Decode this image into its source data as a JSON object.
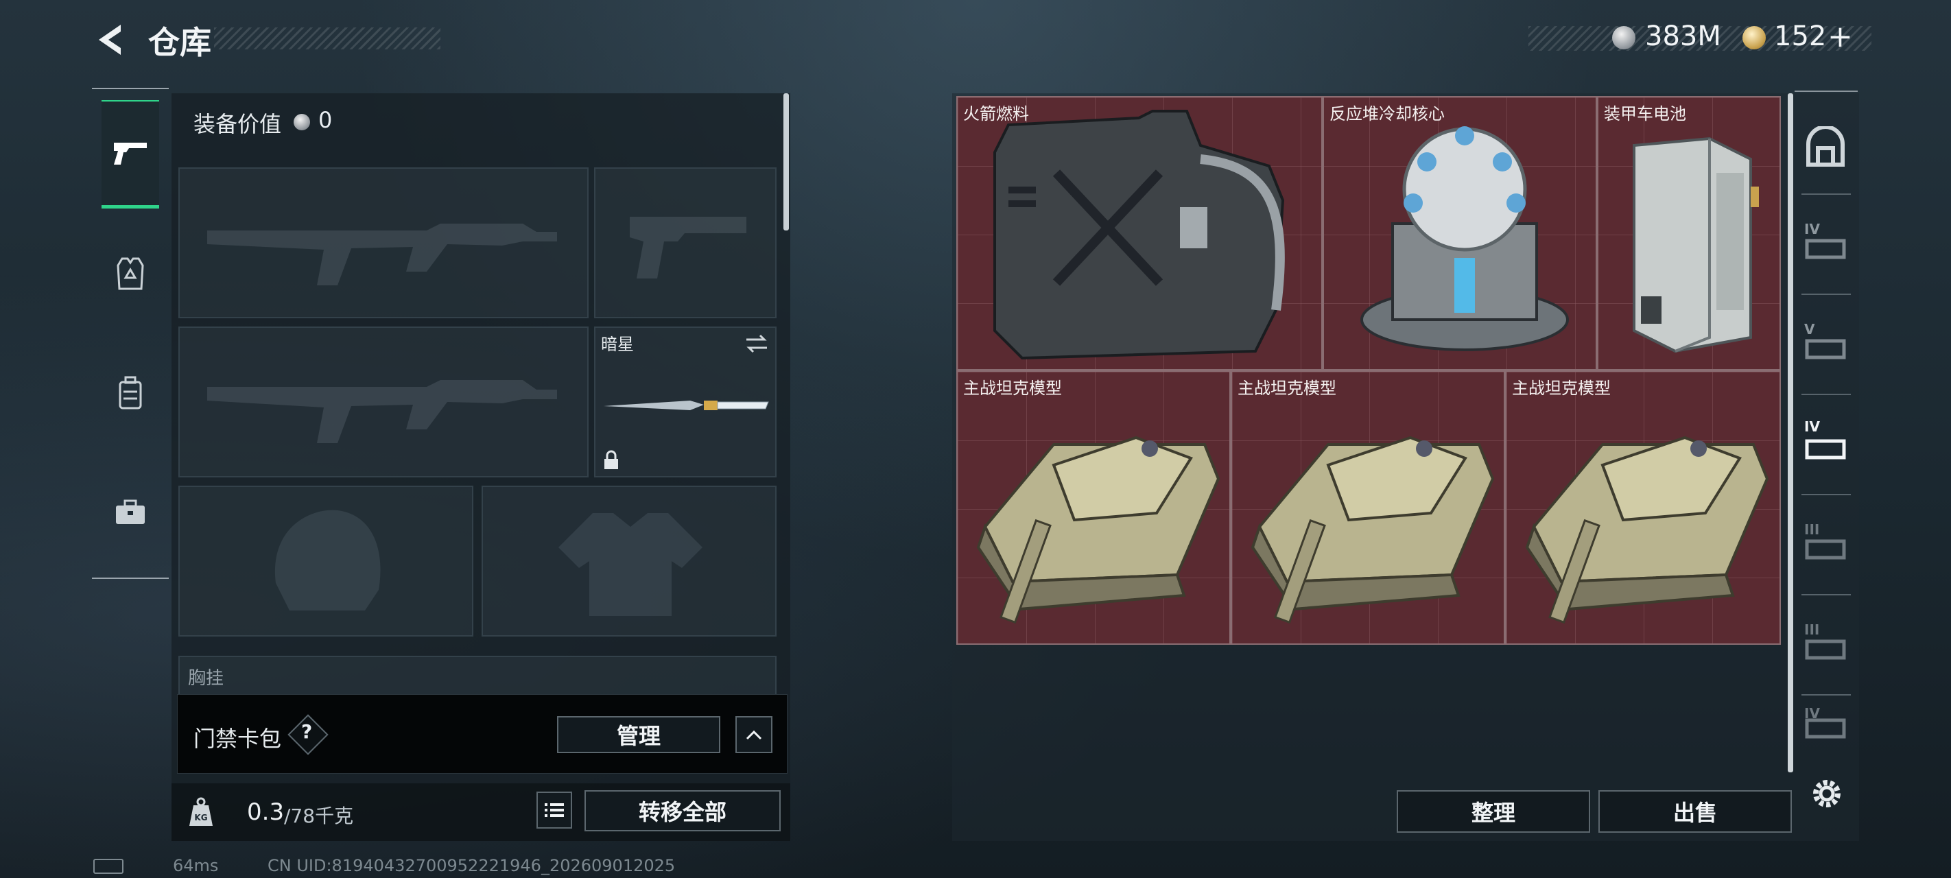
{
  "header": {
    "title": "仓库",
    "currency_silver": "383M",
    "currency_gold": "152",
    "gold_add": "+"
  },
  "left_nav": {
    "items": [
      {
        "name": "weapons",
        "active": true
      },
      {
        "name": "armor",
        "active": false
      },
      {
        "name": "backpack",
        "active": false
      },
      {
        "name": "case",
        "active": false
      }
    ]
  },
  "equipment": {
    "value_label": "装备价值",
    "value": "0",
    "melee_name": "暗星",
    "chest_label": "胸挂",
    "card_pack_label": "门禁卡包",
    "help_glyph": "?",
    "manage_label": "管理",
    "weight_current": "0.3",
    "weight_max": "/78千克",
    "transfer_all_label": "转移全部"
  },
  "storage": {
    "items": [
      {
        "name": "火箭燃料"
      },
      {
        "name": "反应堆冷却核心"
      },
      {
        "name": "装甲车电池"
      },
      {
        "name": "主战坦克模型"
      },
      {
        "name": "主战坦克模型"
      },
      {
        "name": "主战坦克模型"
      }
    ],
    "sort_label": "整理",
    "sell_label": "出售"
  },
  "right_nav": {
    "tiers": [
      "IV",
      "V",
      "IV",
      "III",
      "III",
      "IV"
    ]
  },
  "footer": {
    "ping": "64ms",
    "uid_text": "CN UID:8194043270095222​1946_202609012025"
  },
  "colors": {
    "accent_green": "#2fd48a",
    "grid_red": "#5a2a31"
  }
}
